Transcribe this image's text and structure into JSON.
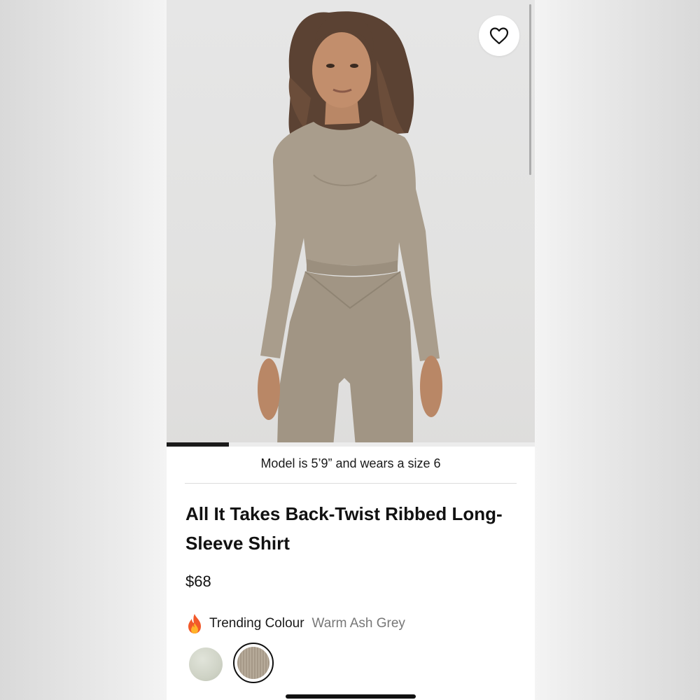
{
  "product": {
    "model_info": "Model is 5’9” and wears a size 6",
    "title": "All It Takes Back-Twist Ribbed Long-Sleeve Shirt",
    "price": "$68",
    "image_gallery_progress": 0.17
  },
  "colour": {
    "trending_label": "Trending Colour",
    "selected_name": "Warm Ash Grey",
    "trending_icon": "fire-icon"
  },
  "swatches": [
    {
      "icon": "swatch-sage",
      "color": "#d3d7cb",
      "selected": false
    },
    {
      "icon": "swatch-warm-ash-grey",
      "color": "#ab9f8e",
      "selected": true
    }
  ],
  "icons": {
    "favorite": "heart-outline-icon"
  },
  "colors": {
    "product_main": "#a99d8c",
    "text_primary": "#111111",
    "text_secondary": "#777777"
  }
}
